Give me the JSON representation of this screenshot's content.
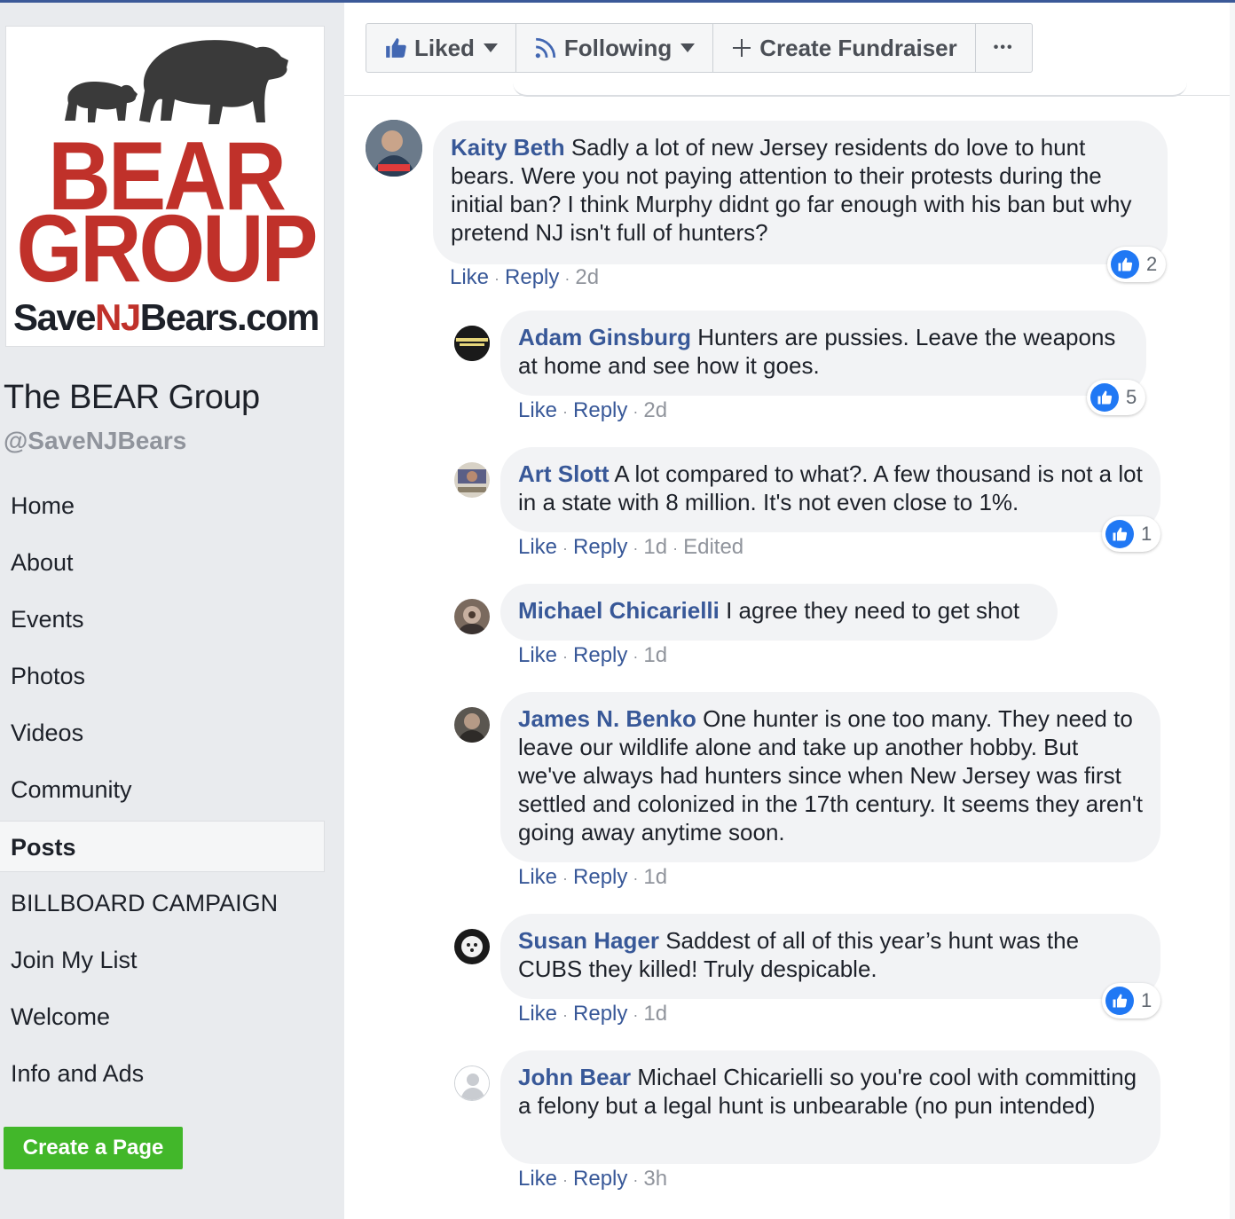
{
  "page": {
    "logo": {
      "word1": "BEAR",
      "word2": "GROUP",
      "site_prefix": "Save",
      "site_nj": "NJ",
      "site_suffix": "Bears.com"
    },
    "name": "The BEAR Group",
    "handle": "@SaveNJBears"
  },
  "nav": {
    "items": [
      {
        "label": "Home"
      },
      {
        "label": "About"
      },
      {
        "label": "Events"
      },
      {
        "label": "Photos"
      },
      {
        "label": "Videos"
      },
      {
        "label": "Community"
      },
      {
        "label": "Posts",
        "active": true
      },
      {
        "label": "BILLBOARD CAMPAIGN"
      },
      {
        "label": "Join My List"
      },
      {
        "label": "Welcome"
      },
      {
        "label": "Info and Ads"
      }
    ],
    "create_page": "Create a Page"
  },
  "actions": {
    "liked": "Liked",
    "following": "Following",
    "fundraiser": "Create Fundraiser",
    "more": "•••"
  },
  "meta_labels": {
    "like": "Like",
    "reply": "Reply",
    "edited": "Edited"
  },
  "comments": [
    {
      "author": "Kaity Beth",
      "text": "Sadly a lot of new Jersey residents do love to hunt bears. Were you not paying attention to their protests during the initial ban? I think Murphy didnt go far enough with his ban but why pretend NJ isn't full of hunters?",
      "time": "2d",
      "likes": "2"
    },
    {
      "author": "Adam Ginsburg",
      "text": "Hunters are pussies. Leave the weapons at home and see how it goes.",
      "time": "2d",
      "likes": "5"
    },
    {
      "author": "Art Slott",
      "text": "A lot compared to what?. A few thousand is not a lot in a state with 8 million. It's not even close to 1%.",
      "time": "1d",
      "likes": "1",
      "edited": true
    },
    {
      "author": "Michael Chicarielli",
      "text": "I agree they need to get shot",
      "time": "1d"
    },
    {
      "author": "James N. Benko",
      "text": "One hunter is one too many. They need to leave our wildlife alone and take up another hobby. But we've always had hunters since when New Jersey was first settled and colonized in the 17th century. It seems they aren't going away anytime soon.",
      "time": "1d"
    },
    {
      "author": "Susan Hager",
      "text": "Saddest of all of this year’s hunt was the CUBS they killed! Truly despicable.",
      "time": "1d",
      "likes": "1"
    },
    {
      "author": "John Bear",
      "text": "Michael Chicarielli so you're cool with committing a felony but a legal hunt is unbearable (no pun intended)",
      "time": "3h"
    }
  ],
  "colors": {
    "link": "#385898",
    "brand_red": "#c0312a",
    "create_green": "#42b72a",
    "like_blue": "#2078f4"
  }
}
